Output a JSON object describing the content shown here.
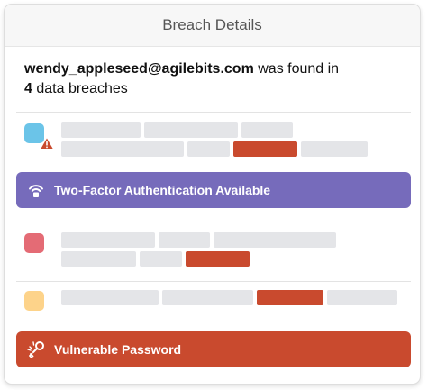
{
  "header": {
    "title": "Breach Details"
  },
  "summary": {
    "email": "wendy_appleseed@agilebits.com",
    "found_text": " was found in",
    "count": "4",
    "breaches_text": " data breaches"
  },
  "banners": {
    "two_factor": "Two-Factor Authentication Available",
    "vulnerable": "Vulnerable Password"
  },
  "colors": {
    "swatch_blue": "#6bc4e8",
    "swatch_red": "#e46b75",
    "swatch_yellow": "#fdd38a",
    "highlight": "#c94a2e",
    "two_factor_banner": "#766bbb",
    "vulnerable_banner": "#c94a2e",
    "placeholder": "#e4e5e8"
  },
  "icons": {
    "warning": "warning-triangle-icon",
    "two_factor": "wifi-lock-icon",
    "vulnerable": "broken-key-icon"
  }
}
